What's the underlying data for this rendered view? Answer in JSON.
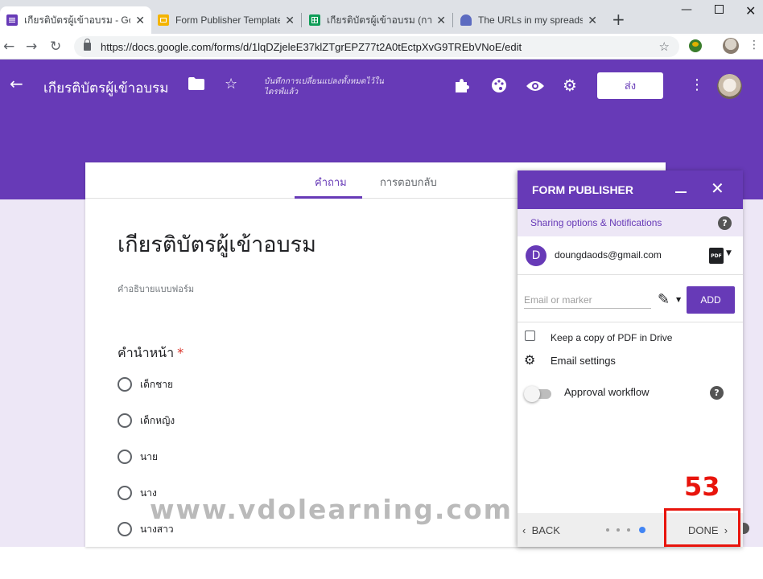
{
  "browser": {
    "tabs": [
      {
        "title": "เกียรติบัตรผู้เข้าอบรม - Goog",
        "favicon": "forms-icon",
        "color": "#673ab7"
      },
      {
        "title": "Form Publisher Template",
        "favicon": "slides-icon",
        "color": "#f4b400"
      },
      {
        "title": "เกียรติบัตรผู้เข้าอบรม (การตอ",
        "favicon": "sheets-icon",
        "color": "#0f9d58"
      },
      {
        "title": "The URLs in my spreadshe",
        "favicon": "addon-icon",
        "color": "#5c6bc0"
      }
    ],
    "new_tab": "+",
    "url": "https://docs.google.com/forms/d/1lqDZjeleE37klZTgrEPZ77t2A0tEctpXvG9TREbVNoE/edit"
  },
  "header": {
    "title": "เกียรติบัตรผู้เข้าอบรม",
    "saved_status": "บันทึกการเปลี่ยนแปลงทั้งหมดไว้ในไดรฟ์แล้ว",
    "send_label": "ส่ง",
    "accent": "#673ab7"
  },
  "form": {
    "tabs": [
      "คำถาม",
      "การตอบกลับ"
    ],
    "title": "เกียรติบัตรผู้เข้าอบรม",
    "description": "คำอธิบายแบบฟอร์ม",
    "question": {
      "title": "คำนำหน้า",
      "required_mark": "*",
      "options": [
        "เด็กชาย",
        "เด็กหญิง",
        "นาย",
        "นาง",
        "นางสาว"
      ]
    }
  },
  "publisher": {
    "title": "FORM PUBLISHER",
    "sharing_label": "Sharing options & Notifications",
    "user_initial": "D",
    "user_email": "doungdaods@gmail.com",
    "pdf_label": "PDF",
    "email_placeholder": "Email or marker",
    "add_label": "ADD",
    "keep_copy_label": "Keep a copy of PDF in Drive",
    "email_settings_label": "Email settings",
    "approval_label": "Approval workflow",
    "back_label": "BACK",
    "done_label": "DONE",
    "step_current": 4,
    "step_total": 4
  },
  "overlay": {
    "watermark": "www.vdolearning.com",
    "step_number": "53",
    "highlight_color": "#e8140c"
  }
}
